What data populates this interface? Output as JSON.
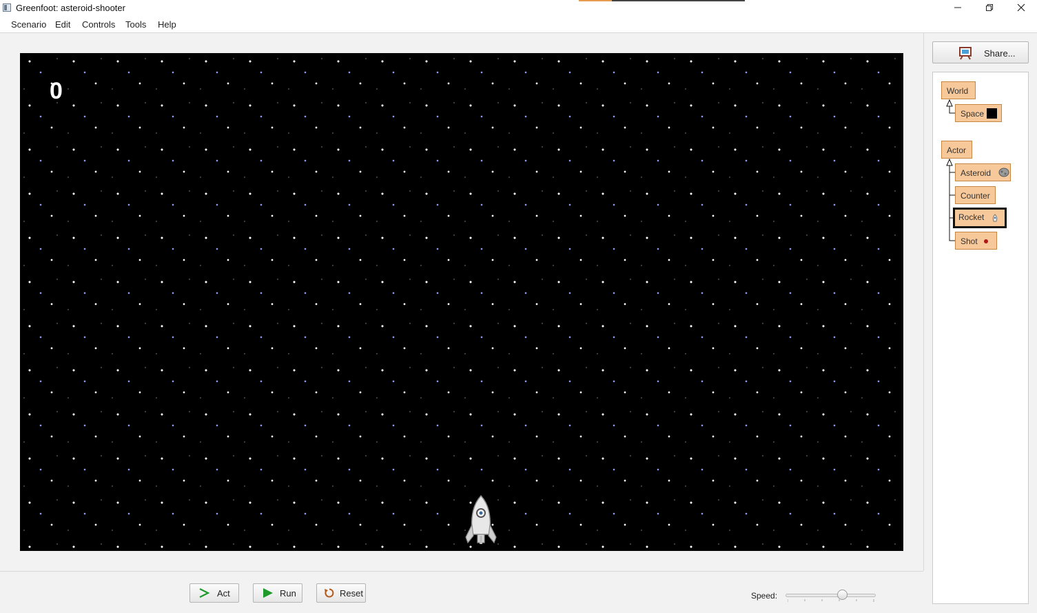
{
  "window": {
    "title": "Greenfoot: asteroid-shooter",
    "minimize_icon": "minimize-icon",
    "maximize_icon": "restore-icon",
    "close_icon": "close-icon"
  },
  "menu": [
    "Scenario",
    "Edit",
    "Controls",
    "Tools",
    "Help"
  ],
  "world": {
    "score": "0",
    "background": "starfield",
    "actor_icon": "rocket-icon"
  },
  "controls": {
    "act_label": "Act",
    "run_label": "Run",
    "reset_label": "Reset",
    "speed_label": "Speed:",
    "speed_value": 0.63
  },
  "share": {
    "label": "Share..."
  },
  "classes": {
    "world_root": "World",
    "world_sub": [
      "Space"
    ],
    "actor_root": "Actor",
    "actor_sub": [
      "Asteroid",
      "Counter",
      "Rocket",
      "Shot"
    ],
    "selected": "Rocket"
  },
  "colors": {
    "class_fill": "#f7c89a",
    "class_border": "#c58640",
    "run_green": "#1f9a2a",
    "world_bg": "#000000"
  }
}
